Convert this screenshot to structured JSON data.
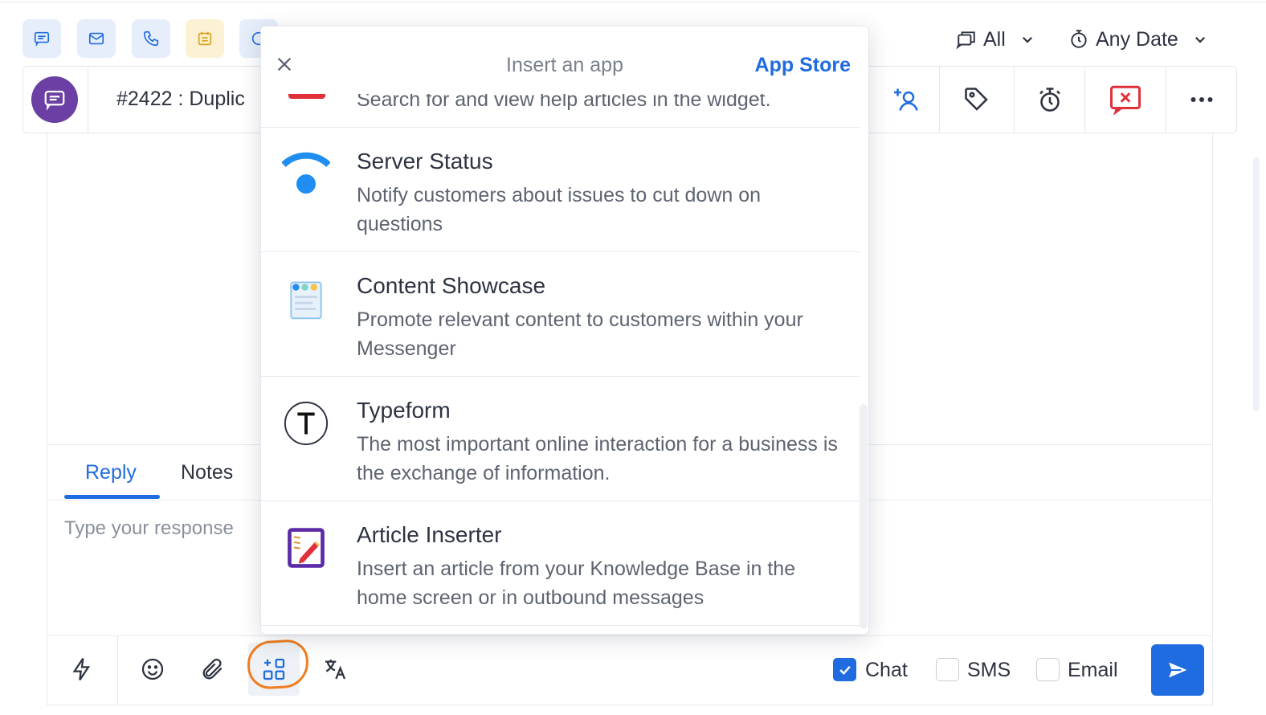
{
  "channels": [
    {
      "name": "chat-filter-icon",
      "bg": "#e6eefb",
      "color": "#1f6ce0"
    },
    {
      "name": "email-filter-icon",
      "bg": "#e6eefb",
      "color": "#1f6ce0"
    },
    {
      "name": "phone-filter-icon",
      "bg": "#e6eefb",
      "color": "#1f6ce0"
    },
    {
      "name": "calendar-filter-icon",
      "bg": "#fdf1d3",
      "color": "#d9a21b"
    },
    {
      "name": "messenger-filter-icon",
      "bg": "#e6eefb",
      "color": "#1f6ce0"
    }
  ],
  "filters": {
    "type_label": "All",
    "date_label": "Any Date"
  },
  "header": {
    "ticket_title": "#2422 : Duplic",
    "avatar_color": "#6b3fa3"
  },
  "composer": {
    "tabs": [
      {
        "label": "Reply",
        "active": true
      },
      {
        "label": "Notes",
        "active": false
      }
    ],
    "placeholder": "Type your response",
    "channels": [
      {
        "label": "Chat",
        "checked": true
      },
      {
        "label": "SMS",
        "checked": false
      },
      {
        "label": "Email",
        "checked": false
      }
    ],
    "accent_color": "#1f6ce0",
    "highlight_color": "#f07d1f"
  },
  "popup": {
    "title": "Insert an app",
    "app_store_label": "App Store",
    "partial_row_text": "Search for and view help articles in the widget.",
    "apps": [
      {
        "name": "Server Status",
        "description": "Notify customers about issues to cut down on questions",
        "icon": "wifi-status-icon"
      },
      {
        "name": "Content Showcase",
        "description": "Promote relevant content to customers within your Messenger",
        "icon": "content-showcase-icon"
      },
      {
        "name": "Typeform",
        "description": "The most important online interaction for a business is the exchange of information.",
        "icon": "typeform-icon"
      },
      {
        "name": "Article Inserter",
        "description": "Insert an article from your Knowledge Base in the home screen or in outbound messages",
        "icon": "article-inserter-icon"
      }
    ]
  }
}
